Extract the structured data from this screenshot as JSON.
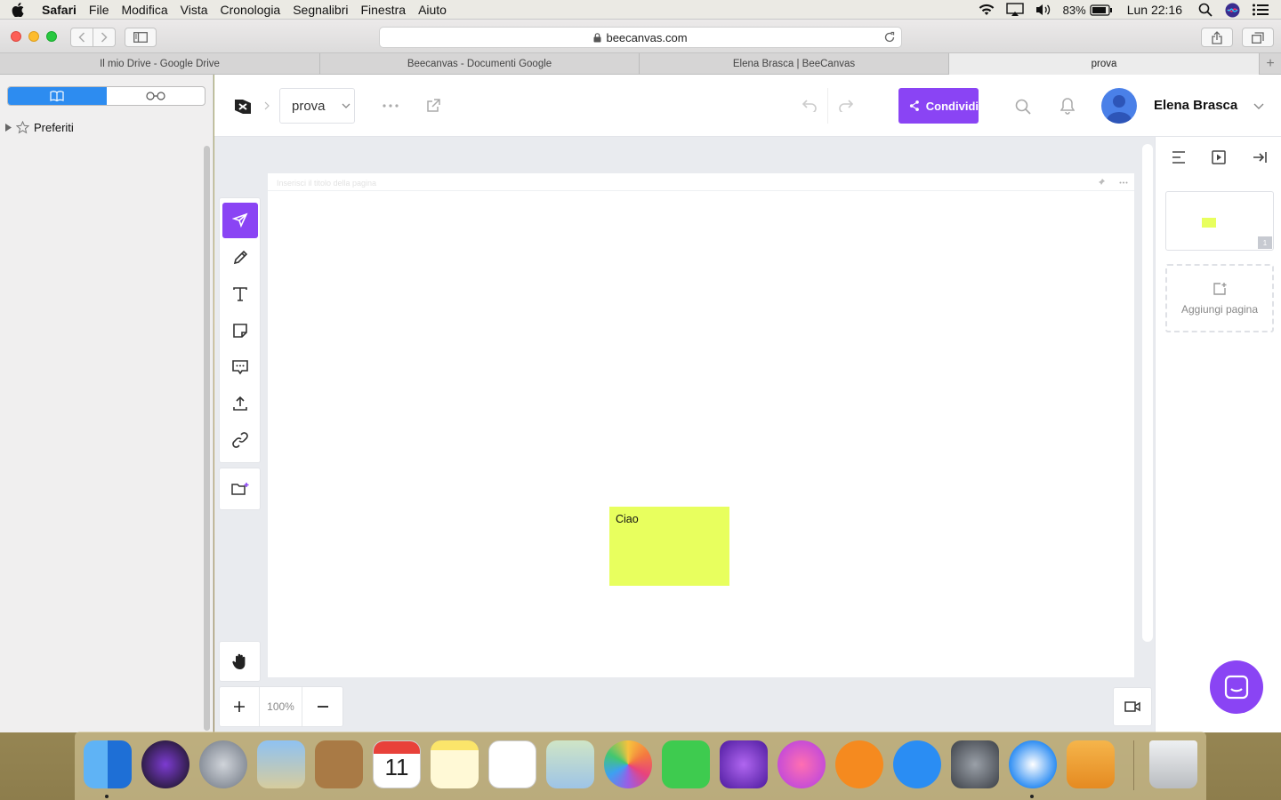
{
  "menubar": {
    "app": "Safari",
    "items": [
      "File",
      "Modifica",
      "Vista",
      "Cronologia",
      "Segnalibri",
      "Finestra",
      "Aiuto"
    ],
    "battery": "83%",
    "clock": "Lun 22:16"
  },
  "browser": {
    "url": "beecanvas.com",
    "tabs": [
      "Il mio Drive - Google Drive",
      "Beecanvas - Documenti Google",
      "Elena Brasca | BeeCanvas",
      "prova"
    ],
    "active_tab": 3
  },
  "sidebar": {
    "favorites_label": "Preferiti"
  },
  "app": {
    "page_name": "prova",
    "share_label": "Condividi",
    "user_name": "Elena Brasca",
    "page_header_hint": "Inserisci il titolo della pagina",
    "note_text": "Ciao",
    "note_color": "#e8ff5e",
    "accent_color": "#8a44f4",
    "zoom": "100%",
    "add_page_label": "Aggiungi pagina",
    "page_number": "1",
    "tools": [
      "select-icon",
      "pen-icon",
      "text-icon",
      "sticky-note-icon",
      "comment-icon",
      "upload-icon",
      "link-icon"
    ]
  }
}
